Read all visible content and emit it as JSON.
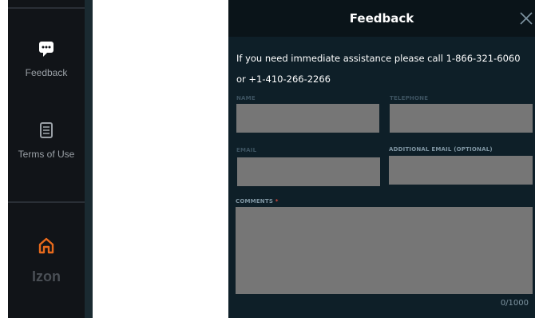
{
  "sidebar": {
    "items": [
      {
        "label": "Feedback",
        "icon": "feedback-icon"
      },
      {
        "label": "Terms of Use",
        "icon": "terms-document-icon"
      }
    ],
    "home": {
      "label": "Izon",
      "icon": "home-icon"
    }
  },
  "colors": {
    "accent_orange": "#e86a1c",
    "modal_bg": "#0e1f28",
    "input_bg": "#767676",
    "required_star": "#d9463b"
  },
  "modal": {
    "title": "Feedback",
    "close_icon": "close-icon",
    "intro": "If you need immediate assistance please call 1-866-321-6060 or +1-410-266-2266",
    "fields": {
      "name": {
        "label": "NAME",
        "value": ""
      },
      "telephone": {
        "label": "TELEPHONE",
        "value": ""
      },
      "email": {
        "label": "EMAIL",
        "value": ""
      },
      "additional_email": {
        "label": "ADDITIONAL EMAIL (OPTIONAL)",
        "value": ""
      },
      "comments": {
        "label": "COMMENTS",
        "required_mark": "*",
        "value": ""
      }
    },
    "counter": "0/1000"
  }
}
